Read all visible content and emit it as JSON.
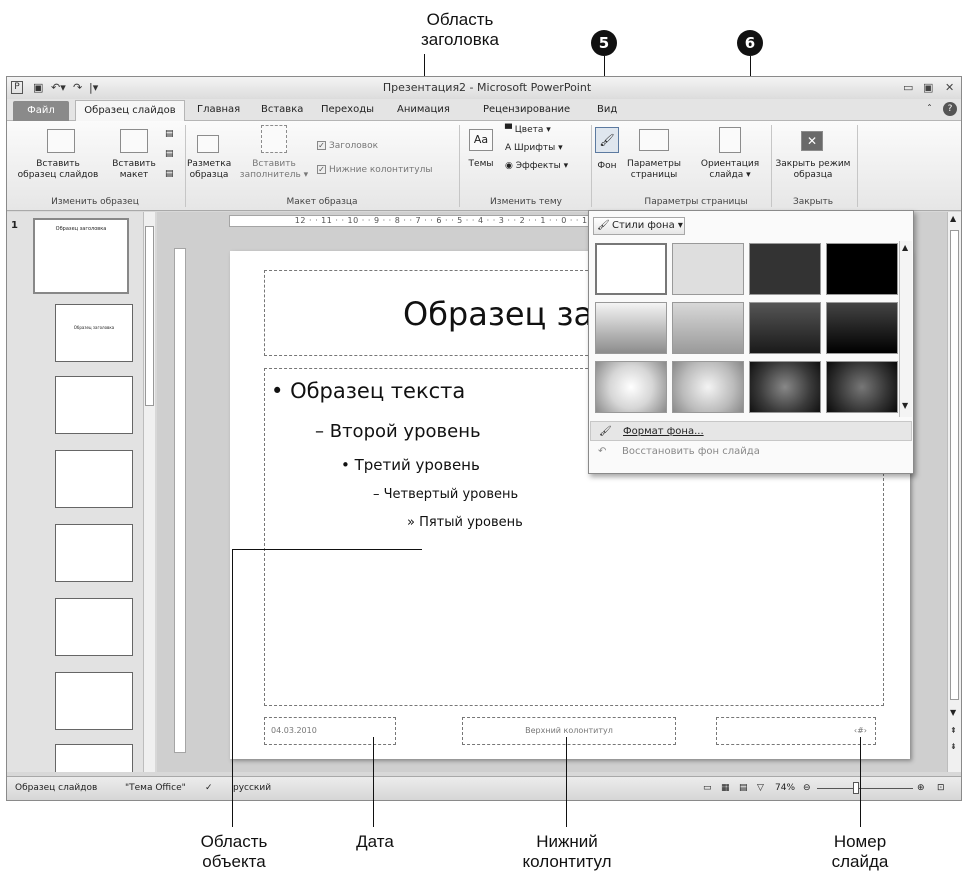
{
  "annotations": {
    "title_area": "Область\nзаголовка",
    "badge_5": "5",
    "badge_6": "6",
    "object_area": "Область\nобъекта",
    "date": "Дата",
    "footer": "Нижний\nколонтитул",
    "slide_number": "Номер\nслайда"
  },
  "window": {
    "title": "Презентация2 - Microsoft PowerPoint",
    "app_icon": "P"
  },
  "tabs": {
    "file": "Файл",
    "active": "Образец слайдов",
    "items": [
      "Главная",
      "Вставка",
      "Переходы",
      "Анимация",
      "Рецензирование",
      "Вид"
    ]
  },
  "ribbon": {
    "insert_master": "Вставить\nобразец слайдов",
    "insert_layout": "Вставить\nмакет",
    "group_edit_master": "Изменить образец",
    "master_layout": "Разметка\nобразца",
    "insert_placeholder": "Вставить\nзаполнитель ▾",
    "cb_title": "Заголовок",
    "cb_footers": "Нижние колонтитулы",
    "group_master_layout": "Макет образца",
    "themes": "Темы",
    "colors": "Цвета ▾",
    "fonts": "Шрифты ▾",
    "effects": "Эффекты ▾",
    "group_edit_theme": "Изменить тему",
    "background": "Фон",
    "page_setup": "Параметры\nстраницы",
    "orientation": "Ориентация\nслайда ▾",
    "group_page_setup": "Параметры страницы",
    "close_master": "Закрыть режим\nобразца",
    "group_close": "Закрыть"
  },
  "ruler": {
    "horizontal": "12 · · 11 · · 10 · · 9 · · 8 · · 7 · · 6 · · 5 · · 4 · · 3 · · 2 · · 1 · · 0 · · 1 · · 2 · · 3 · · 4 · · 5 · · 6 · · 7 · · 8 · · 9 · · 10 · · 11 · · 12"
  },
  "slide": {
    "title": "Образец за",
    "level1": "Образец текста",
    "level2": "– Второй уровень",
    "level3": "• Третий уровень",
    "level4": "– Четвертый уровень",
    "level5": "» Пятый уровень",
    "date": "04.03.2010",
    "footer": "Верхний колонтитул",
    "number": "‹#›"
  },
  "thumbnails": {
    "first_number": "1",
    "first_title": "Образец заголовка",
    "layout_title": "Образец заголовка"
  },
  "dropdown": {
    "button": "Стили фона ▾",
    "format_bg": "Формат фона...",
    "reset_bg": "Восстановить фон слайда"
  },
  "statusbar": {
    "view": "Образец слайдов",
    "theme": "\"Тема Office\"",
    "lang": "русский",
    "zoom": "74%"
  },
  "colors": {
    "swatch_row1": [
      "#ffffff",
      "#dedede",
      "#333333",
      "#000000"
    ]
  }
}
